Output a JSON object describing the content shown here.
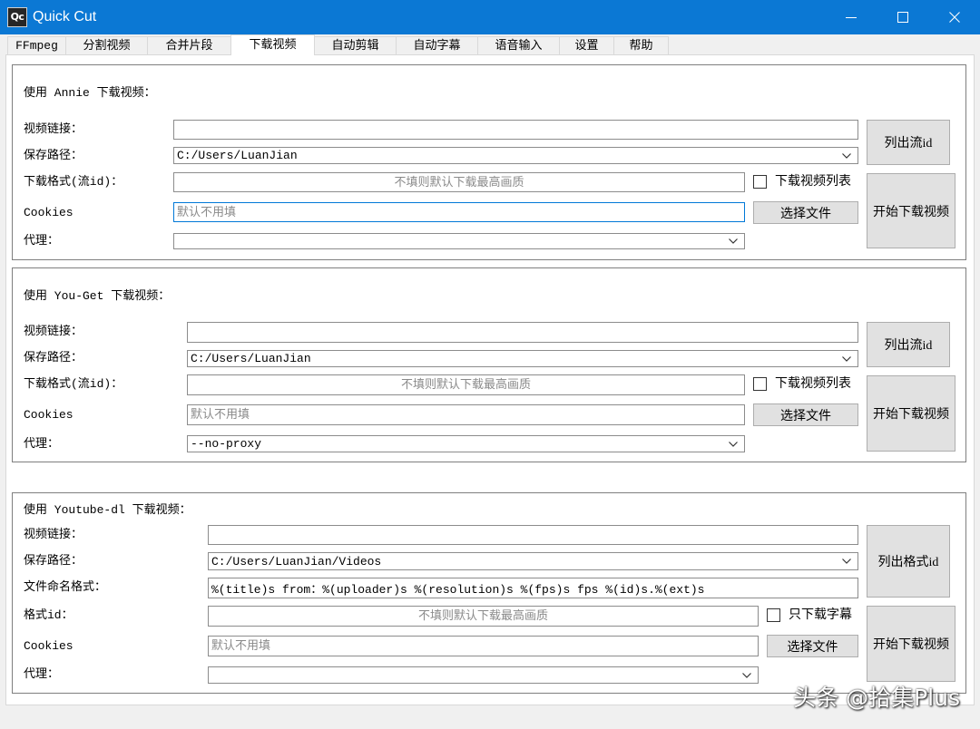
{
  "window": {
    "icon_text": "Qc",
    "title": "Quick Cut"
  },
  "icons": {
    "minimize": "minimize-icon",
    "maximize": "maximize-icon",
    "close": "close-icon",
    "dropdown": "chevron-down-icon",
    "checkbox": "checkbox-icon"
  },
  "colors": {
    "titlebar": "#0b78d4",
    "title_text": "#ffffff",
    "window_bg": "#f0f0f0",
    "focus_border": "#0078d7",
    "placeholder": "#8a8a8a",
    "button_bg": "#e1e1e1"
  },
  "tabs": [
    {
      "label": "FFmpeg",
      "selected": false
    },
    {
      "label": "分割视频",
      "selected": false
    },
    {
      "label": "合并片段",
      "selected": false
    },
    {
      "label": "下载视频",
      "selected": true
    },
    {
      "label": "自动剪辑",
      "selected": false
    },
    {
      "label": "自动字幕",
      "selected": false
    },
    {
      "label": "语音输入",
      "selected": false
    },
    {
      "label": "设置",
      "selected": false
    },
    {
      "label": "帮助",
      "selected": false
    }
  ],
  "annie": {
    "title": "使用 Annie 下载视频：",
    "url": {
      "label": "视频链接：",
      "value": ""
    },
    "save_path": {
      "label": "保存路径：",
      "value": "C:/Users/LuanJian"
    },
    "format": {
      "label": "下载格式(流id)：",
      "value": "",
      "placeholder": "不填则默认下载最高画质"
    },
    "playlist_checkbox": {
      "label": "下载视频列表",
      "checked": false
    },
    "cookies": {
      "label": "Cookies",
      "value": "",
      "placeholder": "默认不用填",
      "focused": true
    },
    "choose_file_button": "选择文件",
    "proxy": {
      "label": "代理：",
      "value": ""
    },
    "list_button": "列出流id",
    "start_button": "开始下载视频"
  },
  "you_get": {
    "title": "使用 You-Get 下载视频：",
    "url": {
      "label": "视频链接：",
      "value": ""
    },
    "save_path": {
      "label": "保存路径：",
      "value": "C:/Users/LuanJian"
    },
    "format": {
      "label": "下载格式(流id)：",
      "value": "",
      "placeholder": "不填则默认下载最高画质"
    },
    "playlist_checkbox": {
      "label": "下载视频列表",
      "checked": false
    },
    "cookies": {
      "label": "Cookies",
      "value": "",
      "placeholder": "默认不用填"
    },
    "choose_file_button": "选择文件",
    "proxy": {
      "label": "代理：",
      "value": "--no-proxy"
    },
    "list_button": "列出流id",
    "start_button": "开始下载视频"
  },
  "youtube_dl": {
    "title": "使用 Youtube-dl 下载视频：",
    "url": {
      "label": "视频链接：",
      "value": ""
    },
    "save_path": {
      "label": "保存路径：",
      "value": "C:/Users/LuanJian/Videos"
    },
    "filename_format": {
      "label": "文件命名格式：",
      "value": "%(title)s from：%(uploader)s %(resolution)s %(fps)s fps %(id)s.%(ext)s"
    },
    "format": {
      "label": "格式id：",
      "value": "",
      "placeholder": "不填则默认下载最高画质"
    },
    "subtitles_only_checkbox": {
      "label": "只下载字幕",
      "checked": false
    },
    "cookies": {
      "label": "Cookies",
      "value": "",
      "placeholder": "默认不用填"
    },
    "choose_file_button": "选择文件",
    "proxy": {
      "label": "代理：",
      "value": ""
    },
    "list_button": "列出格式id",
    "start_button": "开始下载视频"
  },
  "watermark": "头条 @拾集Plus"
}
